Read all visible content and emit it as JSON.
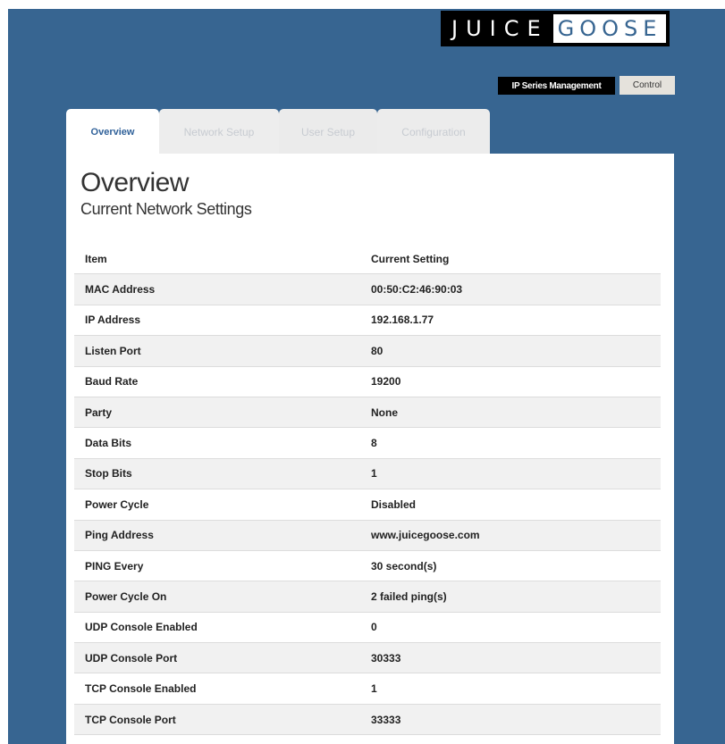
{
  "logo": {
    "part1": "JUICE",
    "part2": "GOOSE"
  },
  "topnav": {
    "ip_series": "IP Series Management",
    "control": "Control"
  },
  "tabs": [
    {
      "label": "Overview",
      "active": true
    },
    {
      "label": "Network Setup",
      "active": false
    },
    {
      "label": "User Setup",
      "active": false
    },
    {
      "label": "Configuration",
      "active": false
    }
  ],
  "page": {
    "title": "Overview",
    "subtitle": "Current Network Settings"
  },
  "table": {
    "headers": [
      "Item",
      "Current Setting"
    ],
    "rows": [
      [
        "MAC Address",
        "00:50:C2:46:90:03"
      ],
      [
        "IP Address",
        "192.168.1.77"
      ],
      [
        "Listen Port",
        "80"
      ],
      [
        "Baud Rate",
        "19200"
      ],
      [
        "Party",
        "None"
      ],
      [
        "Data Bits",
        "8"
      ],
      [
        "Stop Bits",
        "1"
      ],
      [
        "Power Cycle",
        "Disabled"
      ],
      [
        "Ping Address",
        "www.juicegoose.com"
      ],
      [
        "PING Every",
        "30 second(s)"
      ],
      [
        "Power Cycle On",
        "2 failed ping(s)"
      ],
      [
        "UDP Console Enabled",
        "0"
      ],
      [
        "UDP Console Port",
        "30333"
      ],
      [
        "TCP Console Enabled",
        "1"
      ],
      [
        "TCP Console Port",
        "33333"
      ]
    ]
  },
  "colors": {
    "background": "#376591",
    "accent": "#31629a"
  }
}
